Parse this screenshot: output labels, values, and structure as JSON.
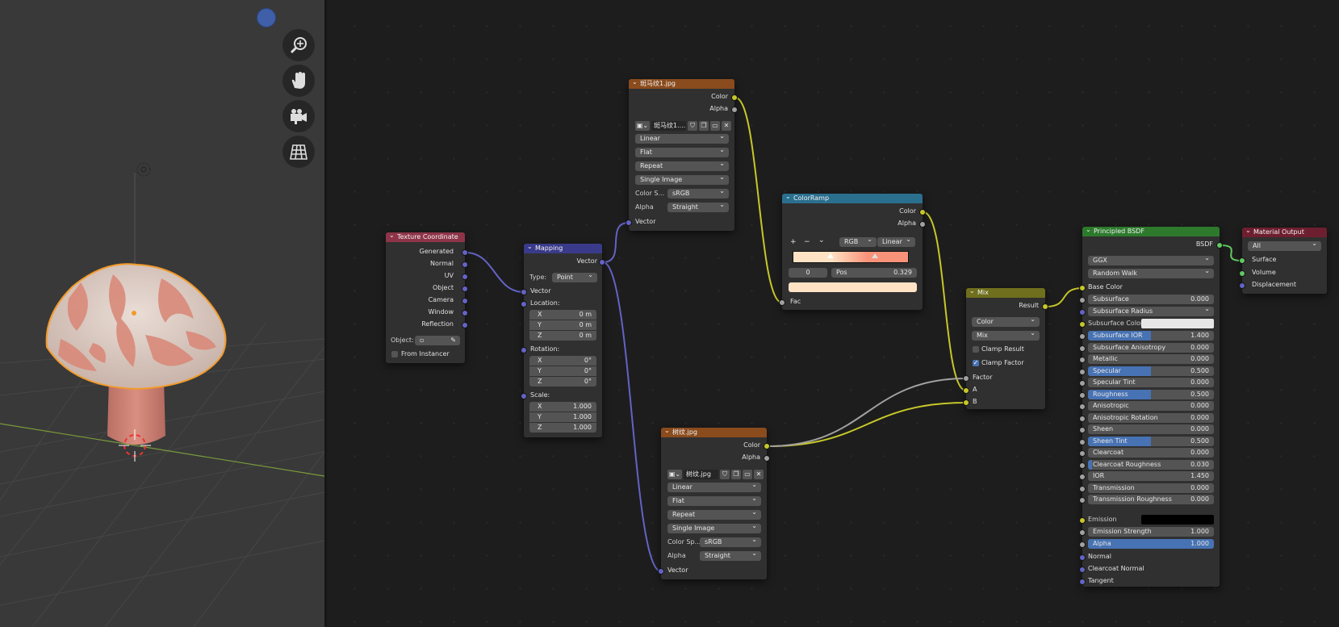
{
  "nodes": {
    "tex_coord": {
      "title": "Texture Coordinate",
      "outputs": [
        "Generated",
        "Normal",
        "UV",
        "Object",
        "Camera",
        "Window",
        "Reflection"
      ],
      "object_label": "Object:",
      "from_instancer": "From Instancer"
    },
    "mapping": {
      "title": "Mapping",
      "output": "Vector",
      "type_label": "Type:",
      "type_value": "Point",
      "input_vector": "Vector",
      "location_label": "Location:",
      "location": [
        {
          "axis": "X",
          "value": "0 m"
        },
        {
          "axis": "Y",
          "value": "0 m"
        },
        {
          "axis": "Z",
          "value": "0 m"
        }
      ],
      "rotation_label": "Rotation:",
      "rotation": [
        {
          "axis": "X",
          "value": "0°"
        },
        {
          "axis": "Y",
          "value": "0°"
        },
        {
          "axis": "Z",
          "value": "0°"
        }
      ],
      "scale_label": "Scale:",
      "scale": [
        {
          "axis": "X",
          "value": "1.000"
        },
        {
          "axis": "Y",
          "value": "1.000"
        },
        {
          "axis": "Z",
          "value": "1.000"
        }
      ]
    },
    "image1": {
      "title": "斑马纹1.jpg",
      "out_color": "Color",
      "out_alpha": "Alpha",
      "image_name": "斑马纹1....",
      "interpolation": "Linear",
      "projection": "Flat",
      "extension": "Repeat",
      "source": "Single Image",
      "color_space_label": "Color S...",
      "color_space": "sRGB",
      "alpha_label": "Alpha",
      "alpha_mode": "Straight",
      "input_vector": "Vector"
    },
    "image2": {
      "title": "树纹.jpg",
      "out_color": "Color",
      "out_alpha": "Alpha",
      "image_name": "树纹.jpg",
      "interpolation": "Linear",
      "projection": "Flat",
      "extension": "Repeat",
      "source": "Single Image",
      "color_space_label": "Color Sp...",
      "color_space": "sRGB",
      "alpha_label": "Alpha",
      "alpha_mode": "Straight",
      "input_vector": "Vector"
    },
    "colorramp": {
      "title": "ColorRamp",
      "out_color": "Color",
      "out_alpha": "Alpha",
      "add": "+",
      "remove": "−",
      "menu": "⌄",
      "mode": "RGB",
      "interp": "Linear",
      "index": "0",
      "pos_label": "Pos",
      "pos_value": "0.329",
      "input_fac": "Fac",
      "stop_color": "#ffe3c4"
    },
    "mix": {
      "title": "Mix",
      "output": "Result",
      "data_type": "Color",
      "blend": "Mix",
      "clamp_result": "Clamp Result",
      "clamp_factor": "Clamp Factor",
      "in_factor": "Factor",
      "in_a": "A",
      "in_b": "B"
    },
    "bsdf": {
      "title": "Principled BSDF",
      "output": "BSDF",
      "distribution": "GGX",
      "subsurface_method": "Random Walk",
      "base_color": "Base Color",
      "subsurface": {
        "label": "Subsurface",
        "value": "0.000"
      },
      "subsurface_radius": "Subsurface Radius",
      "subsurface_color": "Subsurface Color",
      "params": [
        {
          "label": "Subsurface IOR",
          "value": "1.400",
          "fill": 0.5
        },
        {
          "label": "Subsurface Anisotropy",
          "value": "0.000",
          "fill": 0
        },
        {
          "label": "Metallic",
          "value": "0.000",
          "fill": 0
        },
        {
          "label": "Specular",
          "value": "0.500",
          "fill": 0.5
        },
        {
          "label": "Specular Tint",
          "value": "0.000",
          "fill": 0
        },
        {
          "label": "Roughness",
          "value": "0.500",
          "fill": 0.5
        },
        {
          "label": "Anisotropic",
          "value": "0.000",
          "fill": 0
        },
        {
          "label": "Anisotropic Rotation",
          "value": "0.000",
          "fill": 0
        },
        {
          "label": "Sheen",
          "value": "0.000",
          "fill": 0
        },
        {
          "label": "Sheen Tint",
          "value": "0.500",
          "fill": 0.5
        },
        {
          "label": "Clearcoat",
          "value": "0.000",
          "fill": 0
        },
        {
          "label": "Clearcoat Roughness",
          "value": "0.030",
          "fill": 0.03
        },
        {
          "label": "IOR",
          "value": "1.450",
          "fill": 0
        },
        {
          "label": "Transmission",
          "value": "0.000",
          "fill": 0
        },
        {
          "label": "Transmission Roughness",
          "value": "0.000",
          "fill": 0
        }
      ],
      "emission": "Emission",
      "emission_strength": {
        "label": "Emission Strength",
        "value": "1.000"
      },
      "alpha": {
        "label": "Alpha",
        "value": "1.000"
      },
      "normal": "Normal",
      "clearcoat_normal": "Clearcoat Normal",
      "tangent": "Tangent"
    },
    "output": {
      "title": "Material Output",
      "target": "All",
      "surface": "Surface",
      "volume": "Volume",
      "displacement": "Displacement"
    }
  },
  "colors": {
    "header_texcoord": "#8e3449",
    "header_mapping": "#3a3a8a",
    "header_image": "#8a4b1d",
    "header_colorramp": "#2a6f8e",
    "header_mix": "#6f6f1d",
    "header_shader": "#2d7a2d",
    "header_output": "#6e1f2f",
    "accent": "#4772b3"
  }
}
